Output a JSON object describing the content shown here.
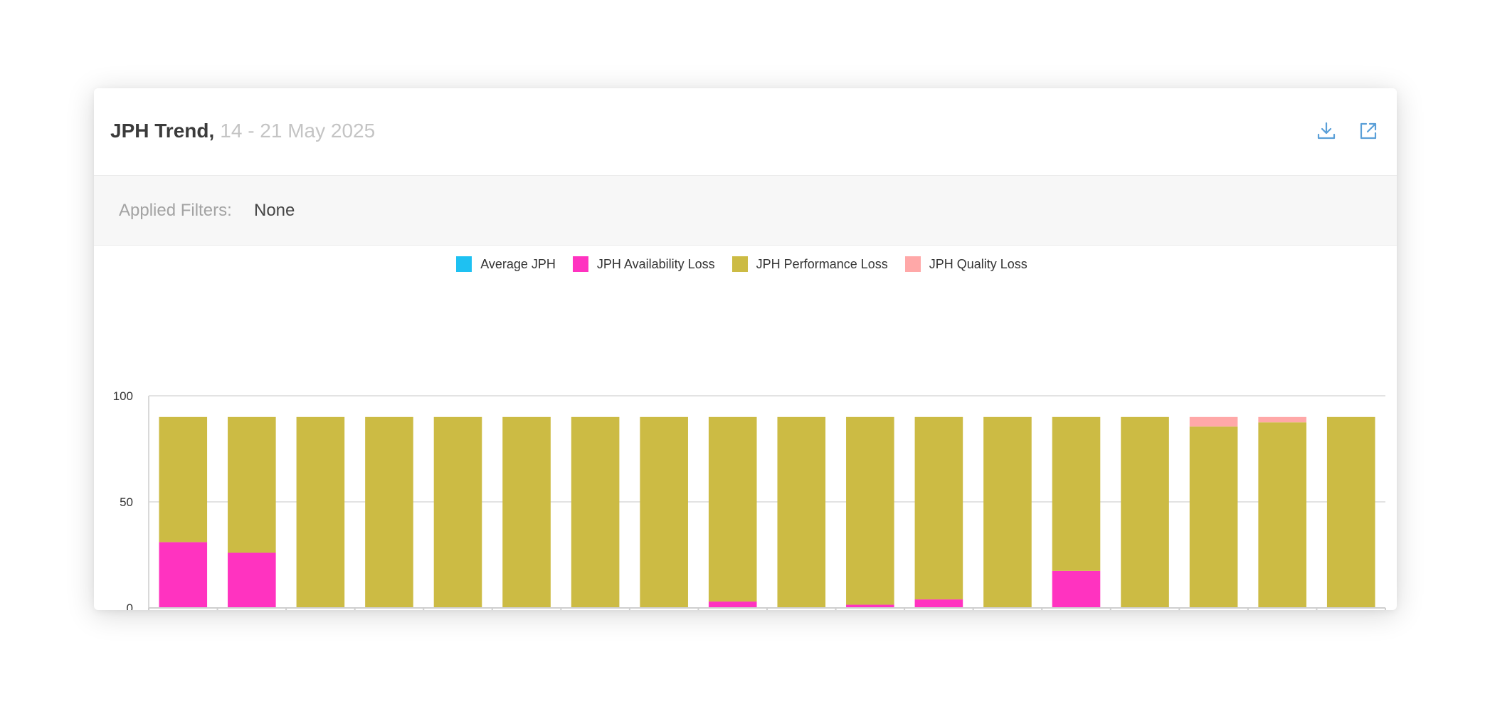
{
  "header": {
    "title": "JPH Trend,",
    "date_range": "14 - 21 May 2025"
  },
  "icons": {
    "download": "download-icon",
    "open": "external-link-icon"
  },
  "filters": {
    "label": "Applied Filters:",
    "value": "None"
  },
  "colors": {
    "average_jph": "#1ec1f2",
    "availability_loss": "#ff33c0",
    "performance_loss": "#ccbb44",
    "quality_loss": "#ffa8a8",
    "icon_blue": "#5a9fd8"
  },
  "chart_data": {
    "type": "bar",
    "stacked": true,
    "ylim": [
      0,
      100
    ],
    "yticks": [
      0,
      50,
      100
    ],
    "grid": true,
    "legend_position": "top-center",
    "categories": [
      "",
      "",
      "",
      "",
      "",
      "",
      "",
      "",
      "",
      "",
      "",
      "",
      "",
      "",
      "",
      "",
      "",
      ""
    ],
    "series": [
      {
        "name": "Average JPH",
        "color_key": "average_jph",
        "values": [
          0,
          0,
          0,
          0,
          0,
          0,
          0,
          0,
          0,
          0,
          0,
          0,
          0,
          0,
          0,
          0,
          0,
          0
        ]
      },
      {
        "name": "JPH Availability Loss",
        "color_key": "availability_loss",
        "values": [
          31,
          26,
          0,
          0,
          0,
          0,
          0,
          0,
          3,
          0,
          1.5,
          4,
          0,
          17.5,
          0,
          0,
          0,
          0
        ]
      },
      {
        "name": "JPH Performance Loss",
        "color_key": "performance_loss",
        "values": [
          59,
          64,
          90,
          90,
          90,
          90,
          90,
          90,
          87,
          90,
          88.5,
          86,
          90,
          72.5,
          90,
          85.5,
          87.5,
          90
        ]
      },
      {
        "name": "JPH Quality Loss",
        "color_key": "quality_loss",
        "values": [
          0,
          0,
          0,
          0,
          0,
          0,
          0,
          0,
          0,
          0,
          0,
          0,
          0,
          0,
          0,
          4.5,
          2.5,
          0
        ]
      }
    ]
  }
}
